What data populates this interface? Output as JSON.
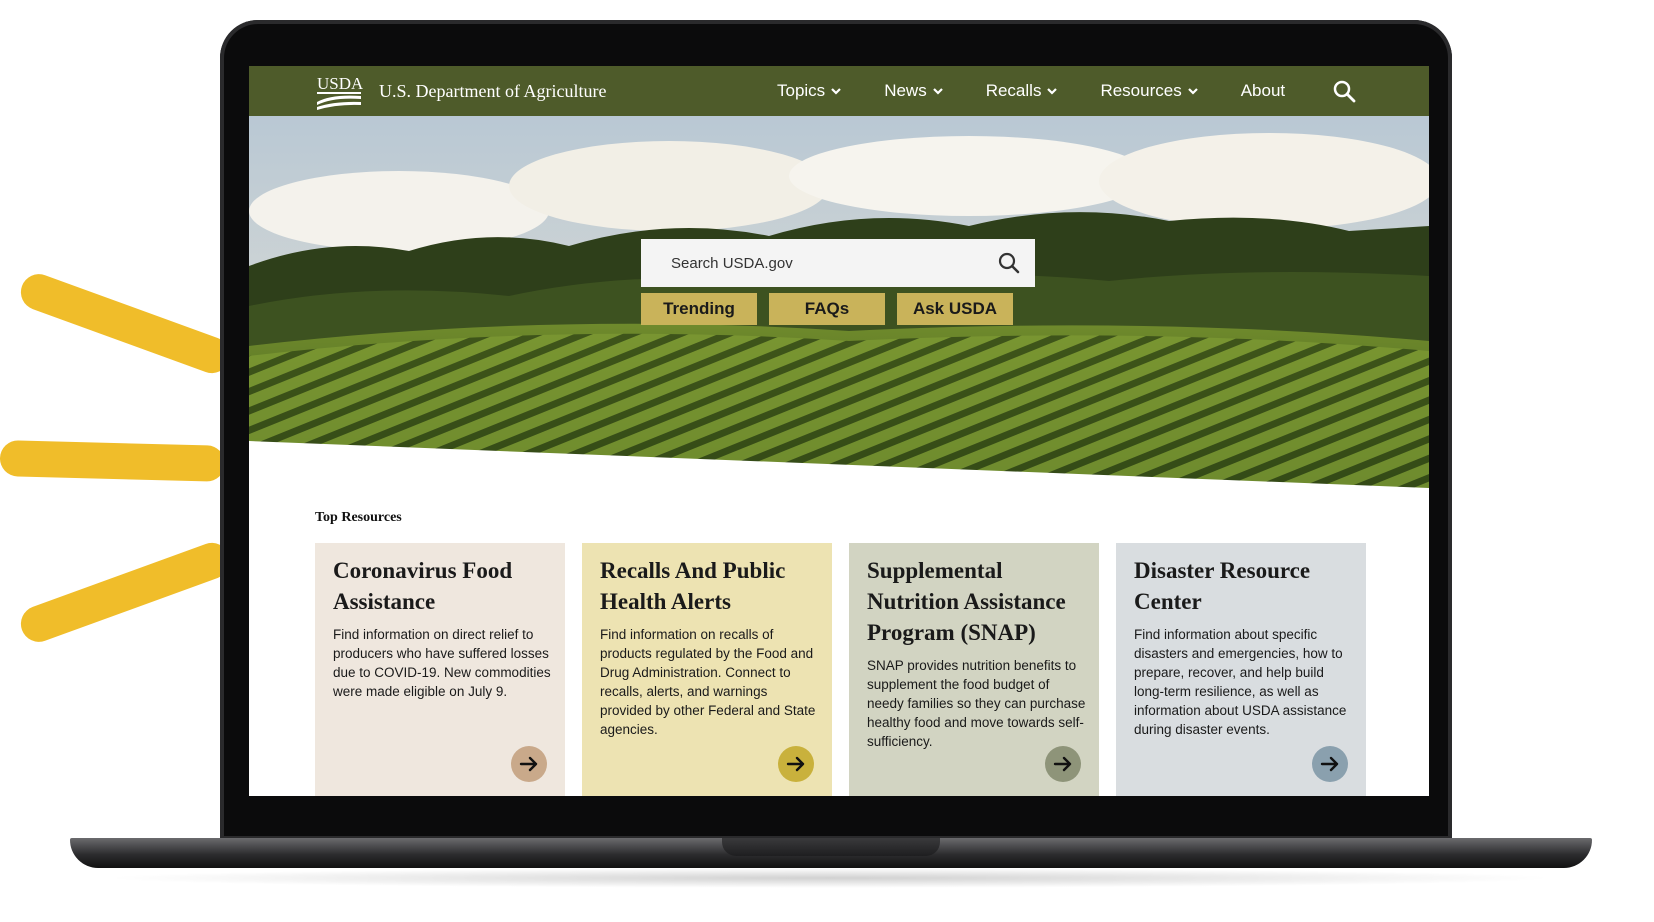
{
  "brand": {
    "logo_text": "USDA",
    "agency_name": "U.S. Department of Agriculture",
    "header_color": "#4e5b2a"
  },
  "nav": [
    {
      "label": "Topics",
      "has_menu": true
    },
    {
      "label": "News",
      "has_menu": true
    },
    {
      "label": "Recalls",
      "has_menu": true
    },
    {
      "label": "Resources",
      "has_menu": true
    },
    {
      "label": "About",
      "has_menu": false
    }
  ],
  "search": {
    "placeholder": "Search USDA.gov"
  },
  "quick_links": [
    "Trending",
    "FAQs",
    "Ask USDA"
  ],
  "top_resources": {
    "heading": "Top Resources",
    "cards": [
      {
        "title": "Coronavirus Food Assistance",
        "body": "Find information on direct relief to producers who have suffered losses due to COVID-19. New commodities were made eligible on July 9.",
        "bg": "#efe7de",
        "arrow_bg": "#c9a98a"
      },
      {
        "title": "Recalls And Public Health Alerts",
        "body": "Find information on recalls of products regulated by the Food and Drug Administration. Connect to recalls, alerts, and warnings provided by other Federal and State agencies.",
        "bg": "#ede3b2",
        "arrow_bg": "#c9b13c"
      },
      {
        "title": "Supplemental Nutrition Assistance Program (SNAP)",
        "body": "SNAP provides nutrition benefits to supplement the food budget of needy families so they can purchase healthy food and move towards self-sufficiency.",
        "bg": "#d2d4c2",
        "arrow_bg": "#8e9479"
      },
      {
        "title": "Disaster Resource Center",
        "body": "Find information about specific disasters and emergencies, how to prepare, recover, and help build long-term resilience, as well as information about USDA assistance during disaster events.",
        "bg": "#d9dde0",
        "arrow_bg": "#8aa0ae"
      }
    ]
  },
  "accent_color": "#f0bd2a"
}
